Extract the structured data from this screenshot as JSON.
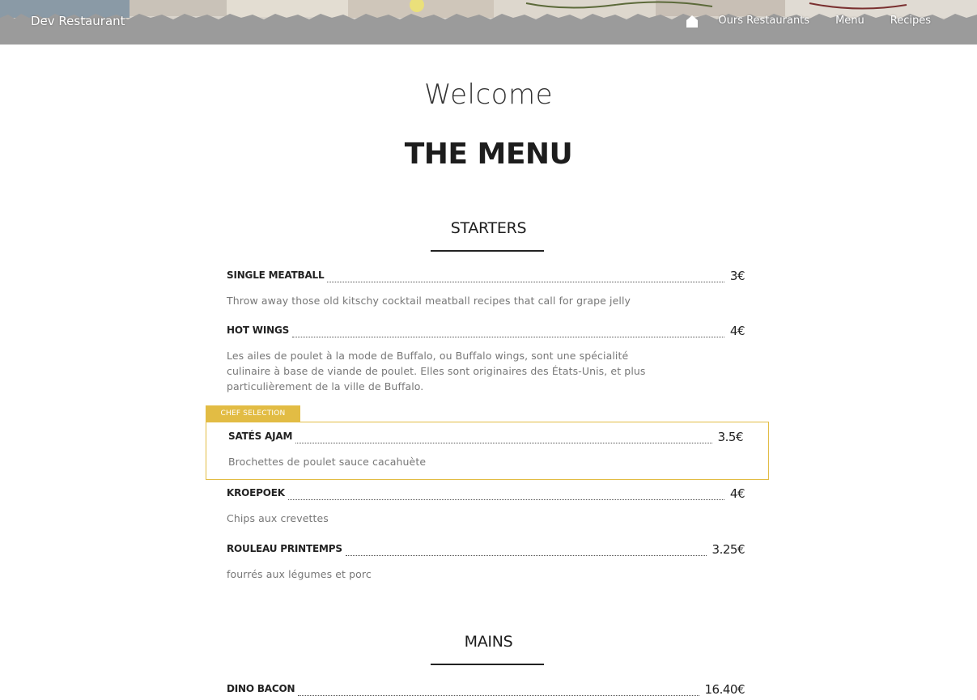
{
  "header": {
    "brand": "Dev Restaurant",
    "nav": {
      "home_icon": "home-icon",
      "links": [
        "Ours Restaurants",
        "Menu",
        "Recipes"
      ]
    }
  },
  "page": {
    "welcome": "Welcome",
    "title": "THE MENU"
  },
  "colors": {
    "accent": "#e2bc44",
    "header_bg": "#9a9a9a",
    "text_dark": "#1d1d1d",
    "text_muted": "#777777"
  },
  "sections": [
    {
      "heading": "STARTERS",
      "items": [
        {
          "name": "SINGLE MEATBALL",
          "price": "3€",
          "description": "Throw away those old kitschy cocktail meatball recipes that call for grape jelly"
        },
        {
          "name": "HOT WINGS",
          "price": "4€",
          "description": "Les ailes de poulet à la mode de Buffalo, ou Buffalo wings, sont une spécialité culinaire à base de viande de poulet. Elles sont originaires des États-Unis, et plus particulièrement de la ville de Buffalo."
        },
        {
          "name": "SATÉS AJAM",
          "price": "3.5€",
          "description": "Brochettes de poulet sauce cacahuète",
          "badge": "CHEF SELECTION"
        },
        {
          "name": "KROEPOEK",
          "price": "4€",
          "description": "Chips aux crevettes"
        },
        {
          "name": "ROULEAU PRINTEMPS",
          "price": "3.25€",
          "description": "fourrés aux légumes et porc"
        }
      ]
    },
    {
      "heading": "MAINS",
      "items": [
        {
          "name": "DINO BACON",
          "price": "16.40€"
        }
      ]
    }
  ]
}
